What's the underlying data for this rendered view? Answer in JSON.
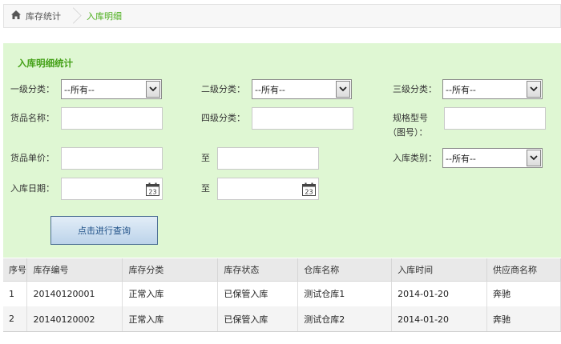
{
  "breadcrumb": {
    "home_label": "库存统计",
    "current_label": "入库明细"
  },
  "panel": {
    "title": "入库明细统计"
  },
  "filters": {
    "level1_label": "一级分类：",
    "level1_value": "--所有--",
    "level2_label": "二级分类：",
    "level2_value": "--所有--",
    "level3_label": "三级分类：",
    "level3_value": "--所有--",
    "goods_name_label": "货品名称：",
    "level4_label": "四级分类：",
    "spec_label_line1": "规格型号",
    "spec_label_line2": "（图号）：",
    "price_label": "货品单价：",
    "to_label": "至",
    "in_type_label": "入库类别：",
    "in_type_value": "--所有--",
    "in_date_label": "入库日期："
  },
  "search_button": "点击进行查询",
  "table": {
    "headers": [
      "序号",
      "库存编号",
      "库存分类",
      "库存状态",
      "仓库名称",
      "入库时间",
      "供应商名称"
    ],
    "rows": [
      [
        "1",
        "20140120001",
        "正常入库",
        "已保管入库",
        "测试仓库1",
        "2014-01-20",
        "奔驰"
      ],
      [
        "2",
        "20140120002",
        "正常入库",
        "已保管入库",
        "测试仓库2",
        "2014-01-20",
        "奔驰"
      ]
    ]
  },
  "icons": {
    "home": "home-icon",
    "calendar": "calendar-icon",
    "dropdown": "chevron-down-icon"
  },
  "colors": {
    "panel_bg": "#dff7d3",
    "accent_green": "#43a016",
    "button_text": "#1d4f86"
  }
}
